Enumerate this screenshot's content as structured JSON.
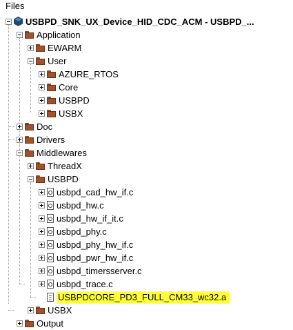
{
  "panel": {
    "title": "Files"
  },
  "tree": {
    "project": "USBPD_SNK_UX_Device_HID_CDC_ACM - USBPD_...",
    "application": "Application",
    "ewarm": "EWARM",
    "user": "User",
    "azure_rtos": "AZURE_RTOS",
    "core": "Core",
    "usbpd_user": "USBPD",
    "usbx_user": "USBX",
    "doc": "Doc",
    "drivers": "Drivers",
    "middlewares": "Middlewares",
    "threadx": "ThreadX",
    "usbpd_mw": "USBPD",
    "files": [
      "usbpd_cad_hw_if.c",
      "usbpd_hw.c",
      "usbpd_hw_if_it.c",
      "usbpd_phy.c",
      "usbpd_phy_hw_if.c",
      "usbpd_pwr_hw_if.c",
      "usbpd_timersserver.c",
      "usbpd_trace.c"
    ],
    "library": "USBPDCORE_PD3_FULL_CM33_wc32.a",
    "usbx_mw": "USBX",
    "output": "Output"
  },
  "colors": {
    "highlight": "#ffff3a",
    "folder": "#a0522d",
    "project": "#1e4a6e"
  }
}
